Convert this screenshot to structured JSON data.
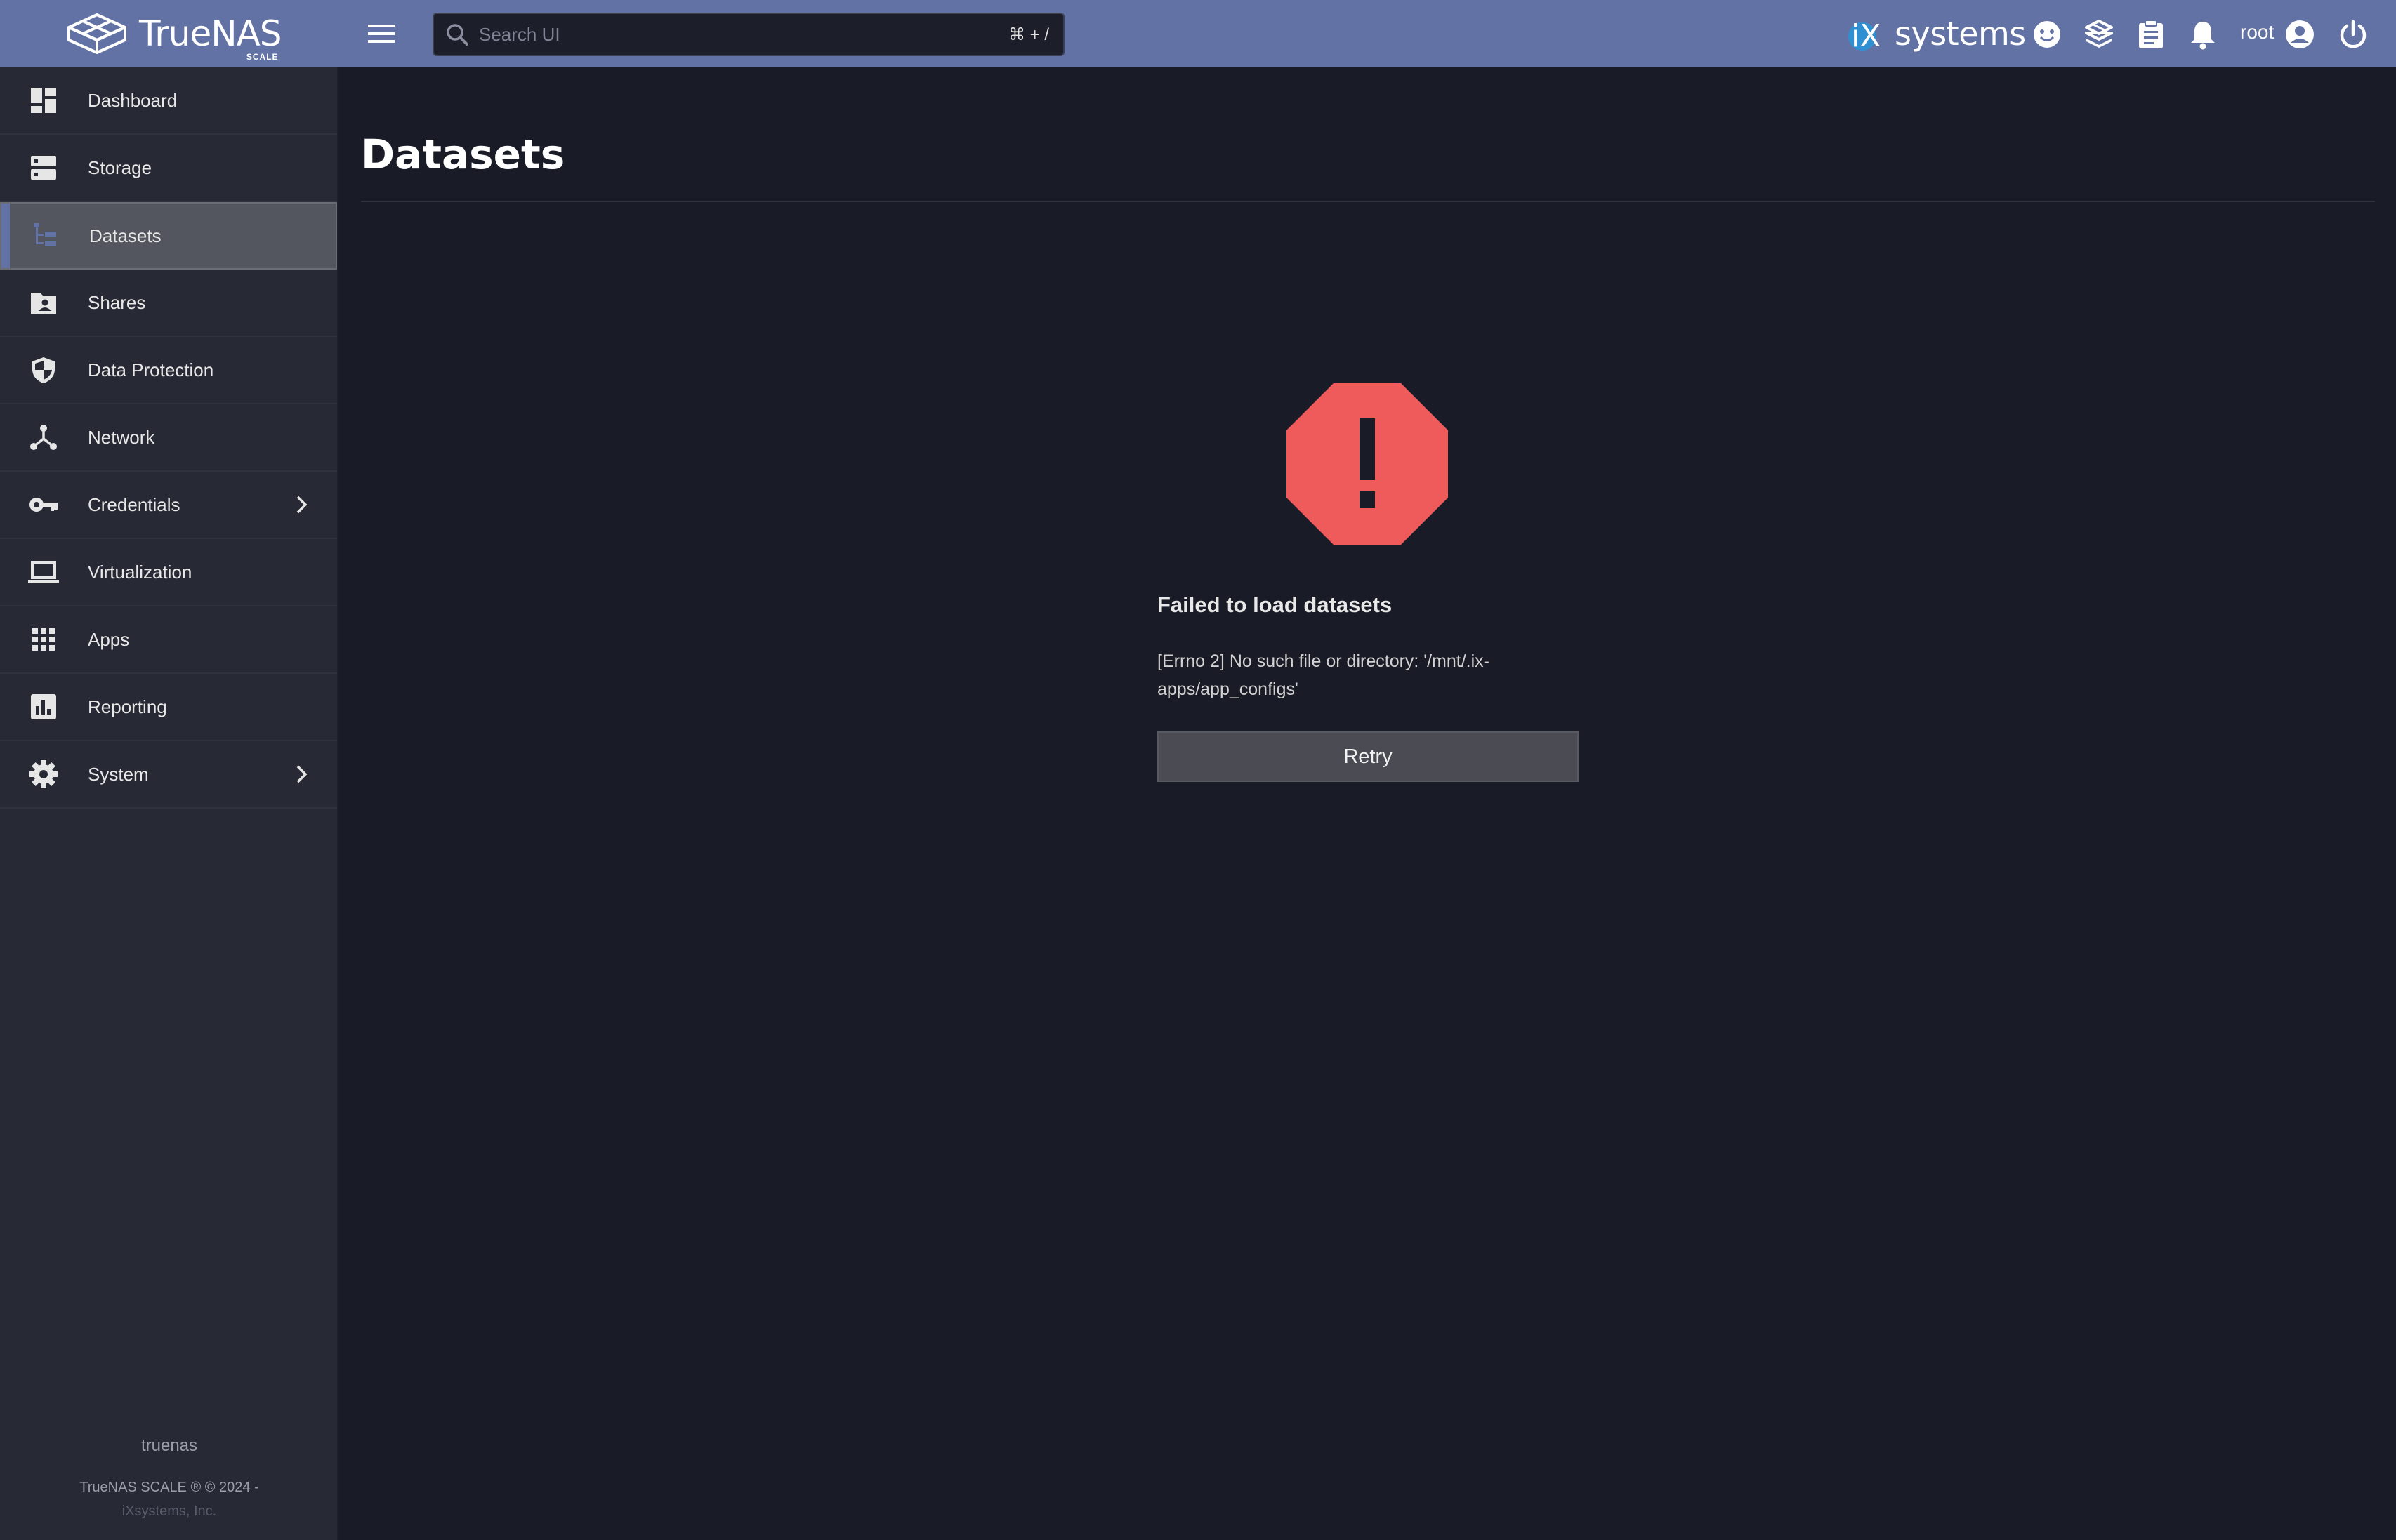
{
  "header": {
    "brand_name": "TrueNAS",
    "brand_edition": "SCALE",
    "search": {
      "placeholder": "Search UI",
      "shortcut": "⌘ + /"
    },
    "vendor_logo_text": "systems",
    "vendor_logo_mark": "iX",
    "user": "root",
    "icons": [
      "menu-icon",
      "search-icon",
      "feedback-icon",
      "truecommand-icon",
      "jobs-icon",
      "notifications-icon",
      "account-icon",
      "power-icon"
    ]
  },
  "sidebar": {
    "items": [
      {
        "label": "Dashboard",
        "icon": "dashboard-icon"
      },
      {
        "label": "Storage",
        "icon": "storage-icon"
      },
      {
        "label": "Datasets",
        "icon": "datasets-icon",
        "active": true
      },
      {
        "label": "Shares",
        "icon": "shares-icon"
      },
      {
        "label": "Data Protection",
        "icon": "shield-icon"
      },
      {
        "label": "Network",
        "icon": "network-icon"
      },
      {
        "label": "Credentials",
        "icon": "key-icon",
        "expandable": true
      },
      {
        "label": "Virtualization",
        "icon": "laptop-icon"
      },
      {
        "label": "Apps",
        "icon": "apps-grid-icon"
      },
      {
        "label": "Reporting",
        "icon": "reporting-icon"
      },
      {
        "label": "System",
        "icon": "gear-icon",
        "expandable": true
      }
    ],
    "hostname": "truenas",
    "copyright_line1": "TrueNAS SCALE ® © 2024 -",
    "copyright_line2": "iXsystems, Inc."
  },
  "main": {
    "page_title": "Datasets",
    "error": {
      "icon": "error-octagon-icon",
      "title": "Failed to load datasets",
      "message": "[Errno 2] No such file or directory: '/mnt/.ix-apps/app_configs'",
      "retry_label": "Retry"
    }
  },
  "colors": {
    "topbar": "#6272a4",
    "sidebar": "#272935",
    "background": "#191b27",
    "error": "#ef5b5b",
    "active_item": "#54565f"
  }
}
